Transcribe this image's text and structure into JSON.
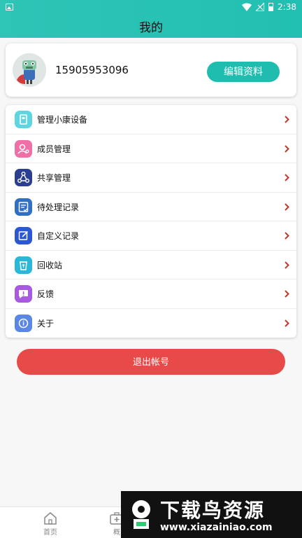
{
  "status_bar": {
    "time": "2:38"
  },
  "header": {
    "title": "我的"
  },
  "profile": {
    "phone": "15905953096",
    "edit_label": "编辑资料"
  },
  "menu": [
    {
      "label": "管理小康设备",
      "icon": "device-icon",
      "color": "#5fd6df"
    },
    {
      "label": "成员管理",
      "icon": "members-icon",
      "color": "#ef6fa6"
    },
    {
      "label": "共享管理",
      "icon": "share-icon",
      "color": "#2a3f8f"
    },
    {
      "label": "待处理记录",
      "icon": "pending-records-icon",
      "color": "#2f6fc4"
    },
    {
      "label": "自定义记录",
      "icon": "custom-records-icon",
      "color": "#2b56d4"
    },
    {
      "label": "回收站",
      "icon": "recycle-bin-icon",
      "color": "#29b8d8"
    },
    {
      "label": "反馈",
      "icon": "feedback-icon",
      "color": "#a85be0"
    },
    {
      "label": "关于",
      "icon": "about-icon",
      "color": "#5a86e4"
    }
  ],
  "logout_label": "退出帐号",
  "tabbar": [
    {
      "label": "首页",
      "icon": "home-icon"
    },
    {
      "label": "概",
      "icon": "medical-kit-icon"
    }
  ],
  "watermark": {
    "title": "下载鸟资源",
    "url": "www.xiazainiao.com"
  },
  "colors": {
    "accent": "#22c0b2",
    "logout": "#e84a4a",
    "chevron": "#c0392b"
  }
}
